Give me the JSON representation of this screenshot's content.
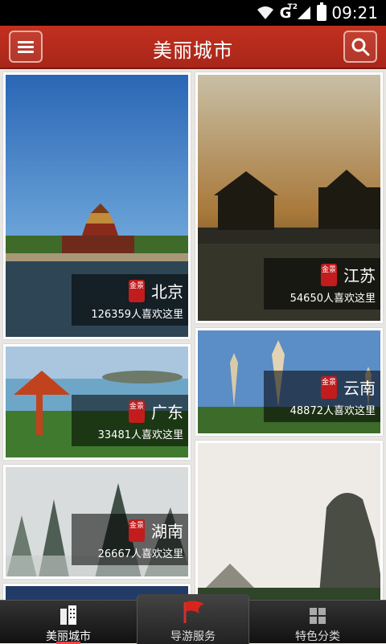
{
  "status": {
    "network": "G",
    "network_sub": "T2",
    "time": "09:21"
  },
  "header": {
    "title": "美丽城市"
  },
  "seal_text": "金景",
  "cities": [
    {
      "name": "北京",
      "likes": "126359人喜欢这里"
    },
    {
      "name": "江苏",
      "likes": "54650人喜欢这里"
    },
    {
      "name": "广东",
      "likes": "33481人喜欢这里"
    },
    {
      "name": "云南",
      "likes": "48872人喜欢这里"
    },
    {
      "name": "湖南",
      "likes": "26667人喜欢这里"
    }
  ],
  "tabs": [
    {
      "label": "美丽城市",
      "icon": "building-icon"
    },
    {
      "label": "导游服务",
      "icon": "flag-icon"
    },
    {
      "label": "特色分类",
      "icon": "grid-icon"
    }
  ]
}
